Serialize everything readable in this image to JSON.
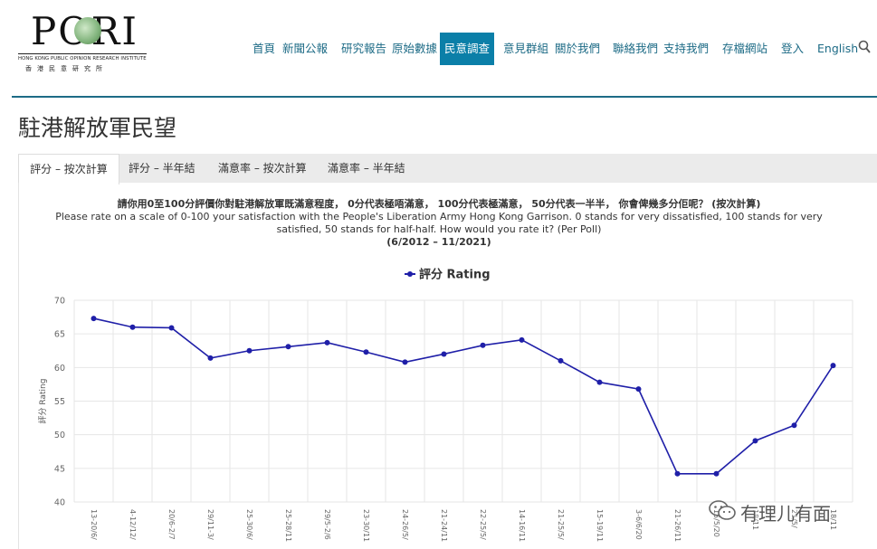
{
  "logo": {
    "wordmark": "PORI",
    "org_en": "HONG KONG PUBLIC OPINION RESEARCH INSTITUTE",
    "org_zh": "香港民意研究所"
  },
  "nav": {
    "items": [
      "首頁",
      "新聞公報",
      "研究報告",
      "原始數據",
      "民意調查",
      "意見群組",
      "關於我們",
      "聯絡我們",
      "支持我們",
      "存檔網站",
      "登入",
      "English"
    ],
    "active_index": 4,
    "search_icon": "search-icon"
  },
  "page_title": "駐港解放軍民望",
  "tabs": [
    "評分 – 按次計算",
    "評分 – 半年結",
    "滿意率 – 按次計算",
    "滿意率 – 半年結"
  ],
  "active_tab": 0,
  "question": {
    "zh": "請你用0至100分評價你對駐港解放軍既滿意程度，  0分代表極唔滿意，  100分代表極滿意，  50分代表一半半，  你會俾幾多分佢呢？  (按次計算)",
    "en": "Please rate on a scale of 0-100 your satisfaction with the People's Liberation Army Hong Kong Garrison. 0 stands for very dissatisfied, 100 stands for very satisfied, 50 stands for half-half. How would you rate it? (Per Poll)",
    "range": "(6/2012 – 11/2021)"
  },
  "chart_data": {
    "type": "line",
    "legend": "評分 Rating",
    "ylabel": "評分 Rating",
    "xlabel": "",
    "ylim": [
      40,
      70
    ],
    "yticks": [
      40,
      45,
      50,
      55,
      60,
      65,
      70
    ],
    "x_tick_labels": [
      "13-20/6/",
      "4-12/12/",
      "20/6-2/7",
      "29/11-3/",
      "25-30/6/",
      "25-28/11",
      "29/5-2/6",
      "23-30/11",
      "24-26/5/",
      "21-24/11",
      "22-25/5/",
      "14-16/11",
      "21-25/5/",
      "15-19/11",
      "3-6/6/20",
      "21-26/11",
      "15/5/20",
      "18/11",
      "21/5/",
      "18/11"
    ],
    "x_tick_visible": [
      true,
      true,
      true,
      true,
      true,
      true,
      true,
      true,
      true,
      true,
      true,
      true,
      true,
      true,
      true,
      true,
      true,
      true,
      true,
      true
    ],
    "grid": true,
    "color": "#1f1fa8",
    "series": [
      {
        "name": "評分 Rating",
        "values": [
          67.3,
          66.0,
          65.9,
          61.4,
          62.5,
          63.1,
          63.7,
          62.3,
          60.8,
          62.0,
          63.3,
          64.1,
          61.0,
          57.8,
          56.8,
          44.2,
          44.2,
          49.1,
          51.4,
          60.3
        ]
      }
    ]
  },
  "watermark": "有理儿有面"
}
